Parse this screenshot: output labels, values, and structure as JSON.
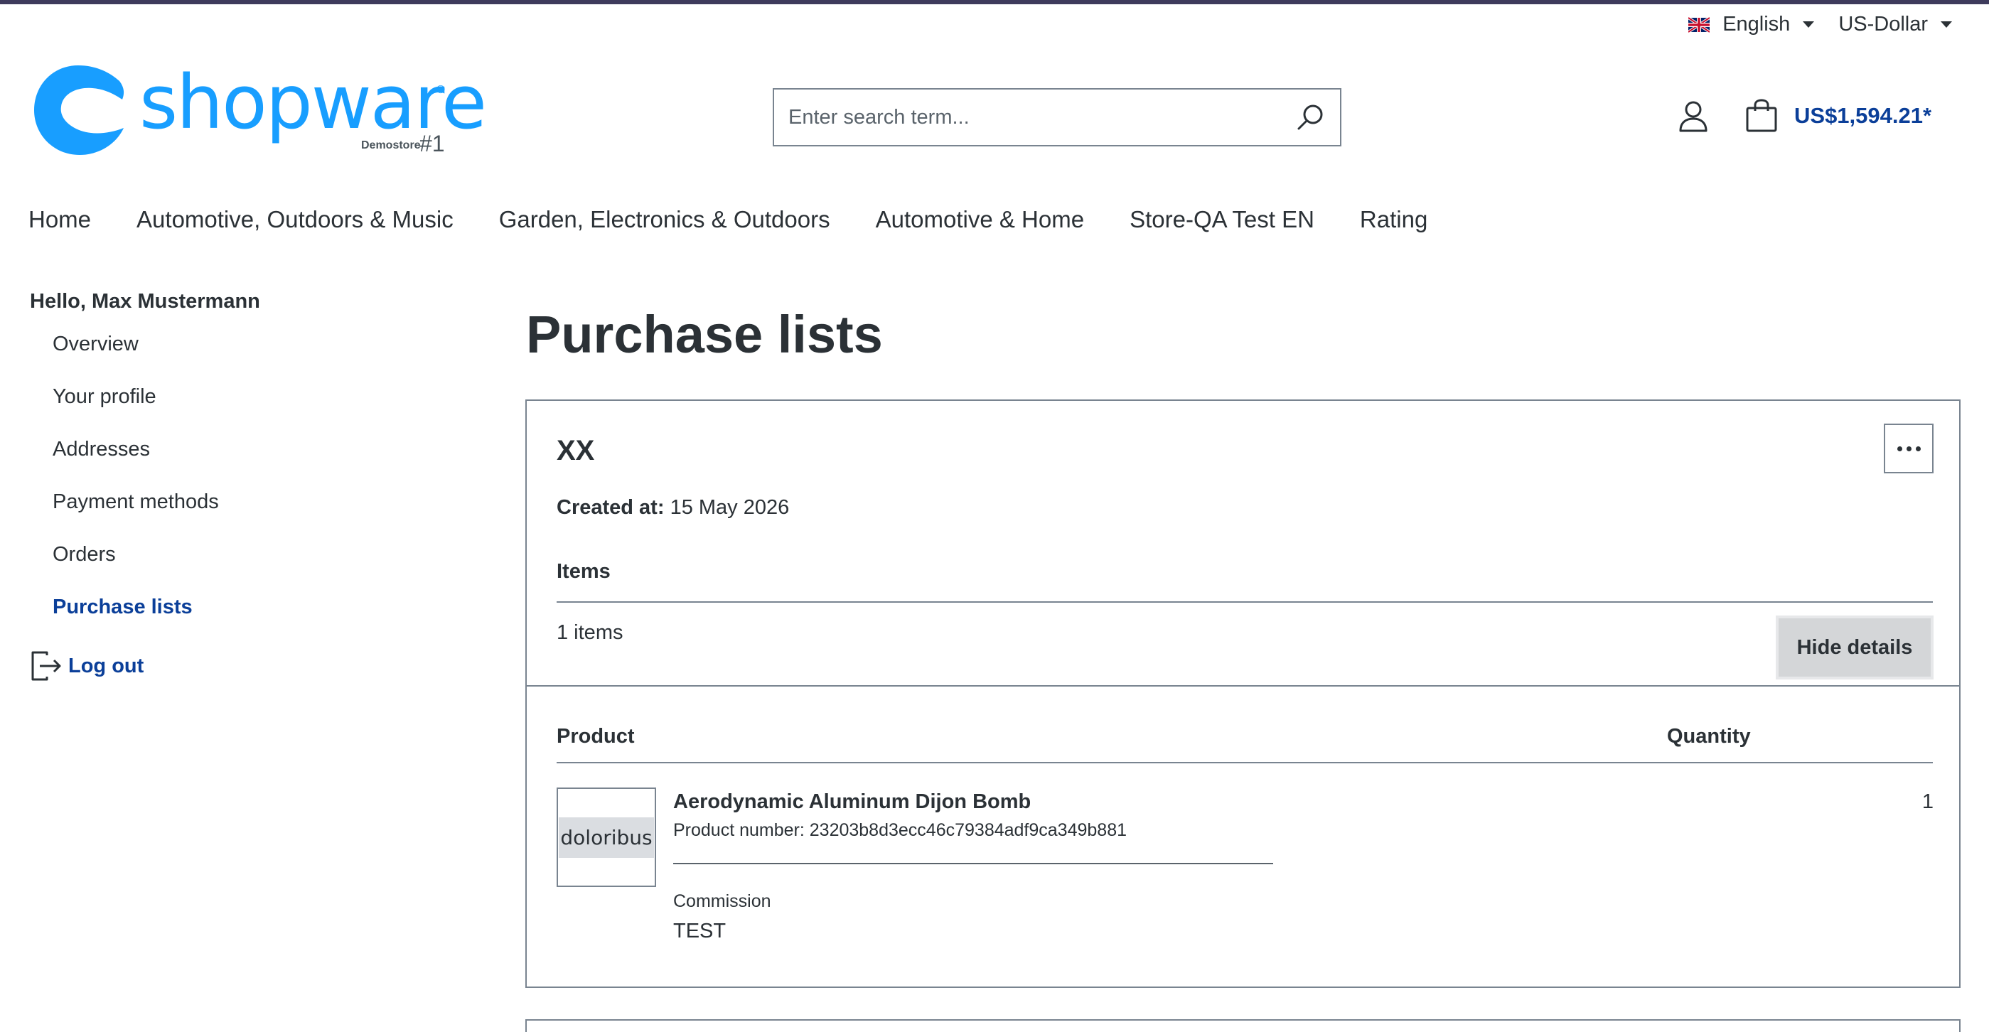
{
  "topbar": {
    "language": "English",
    "currency": "US-Dollar",
    "language_flag": "uk-flag-icon"
  },
  "logo": {
    "text": "shopware",
    "demostore": "Demostore",
    "number": "#1"
  },
  "search": {
    "placeholder": "Enter search term..."
  },
  "cart": {
    "total": "US$1,594.21*"
  },
  "mainnav": {
    "items": [
      {
        "label": "Home"
      },
      {
        "label": "Automotive, Outdoors & Music"
      },
      {
        "label": "Garden, Electronics & Outdoors"
      },
      {
        "label": "Automotive & Home"
      },
      {
        "label": "Store-QA Test EN"
      },
      {
        "label": "Rating"
      }
    ]
  },
  "sidebar": {
    "greeting": "Hello, Max Mustermann",
    "items": [
      {
        "label": "Overview"
      },
      {
        "label": "Your profile"
      },
      {
        "label": "Addresses"
      },
      {
        "label": "Payment methods"
      },
      {
        "label": "Orders"
      },
      {
        "label": "Purchase lists"
      }
    ],
    "logout": "Log out"
  },
  "main": {
    "title": "Purchase lists",
    "list": {
      "name": "XX",
      "created_label": "Created at:",
      "created_value": "15 May 2026",
      "items_heading": "Items",
      "items_count": "1 items",
      "hide_details": "Hide details",
      "col_product": "Product",
      "col_quantity": "Quantity",
      "product": {
        "thumb_text": "doloribus",
        "name": "Aerodynamic Aluminum Dijon Bomb",
        "number": "Product number: 23203b8d3ecc46c79384adf9ca349b881",
        "commission_label": "Commission",
        "commission_value": "TEST",
        "quantity": "1"
      }
    }
  },
  "colors": {
    "brand": "#189eff",
    "link": "#0b3f99",
    "text": "#2b3136",
    "border": "#798490"
  }
}
